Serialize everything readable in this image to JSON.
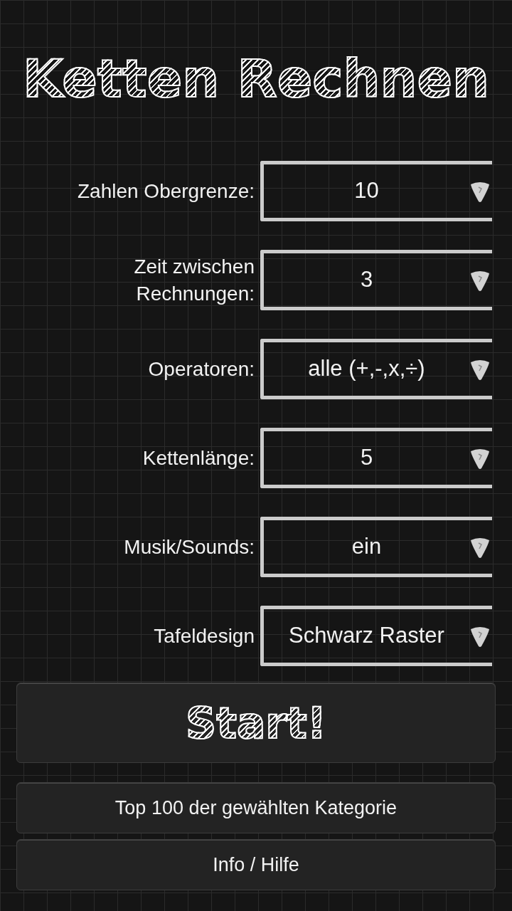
{
  "title": "Ketten Rechnen",
  "settings": [
    {
      "label": "Zahlen Obergrenze:",
      "value": "10"
    },
    {
      "label": "Zeit zwischen Rechnungen:",
      "value": "3"
    },
    {
      "label": "Operatoren:",
      "value": "alle (+,-,x,÷)"
    },
    {
      "label": "Kettenlänge:",
      "value": "5"
    },
    {
      "label": "Musik/Sounds:",
      "value": "ein"
    },
    {
      "label": "Tafeldesign",
      "value": "Schwarz Raster"
    }
  ],
  "buttons": [
    {
      "label": "Start!",
      "kind": "primary"
    },
    {
      "label": "Top 100 der gewählten Kategorie",
      "kind": "secondary"
    },
    {
      "label": "Info / Hilfe",
      "kind": "secondary"
    }
  ]
}
